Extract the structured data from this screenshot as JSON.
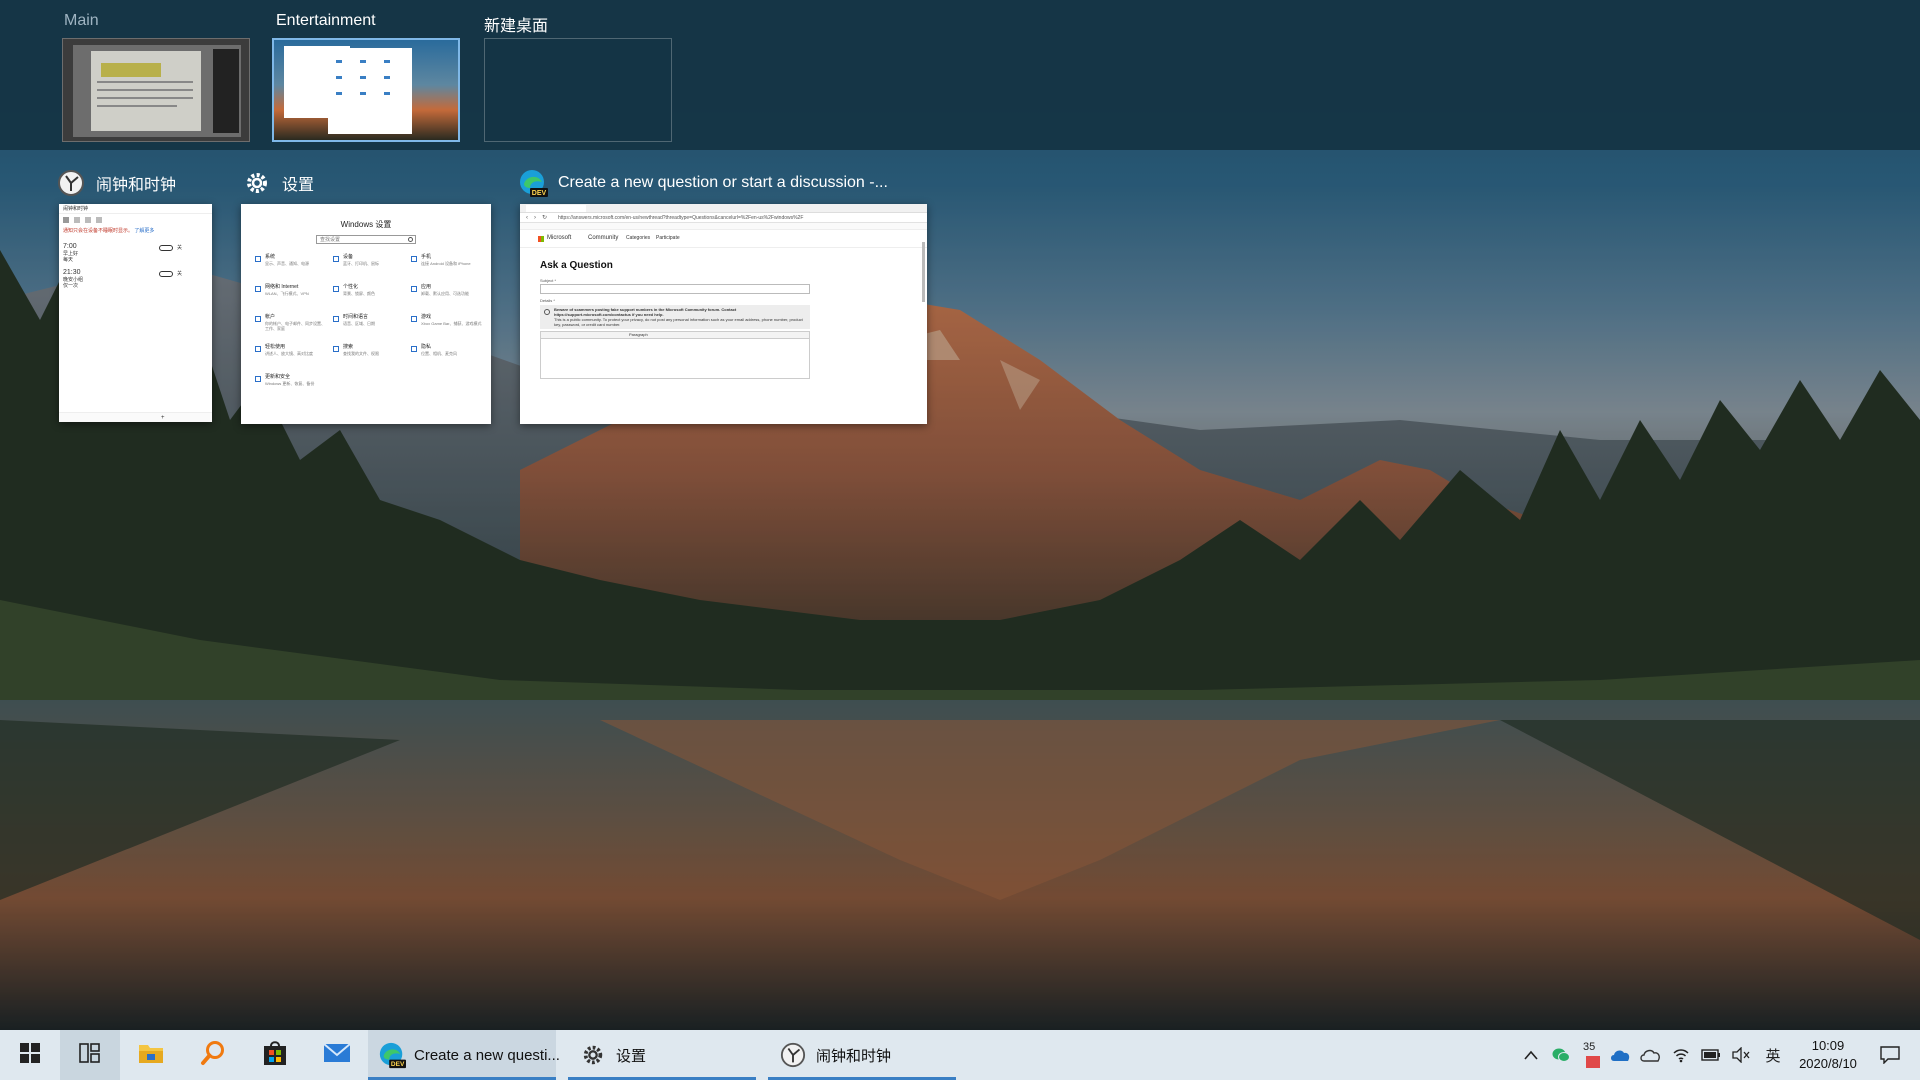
{
  "desktops": [
    {
      "label": "Main",
      "active": false
    },
    {
      "label": "Entertainment",
      "active": true
    },
    {
      "label": "新建桌面",
      "active": false
    }
  ],
  "windows": {
    "clock": {
      "title": "闹钟和时钟",
      "app_name": "闹钟和时钟",
      "notice": "通知只会在设备不睡眠时显示。",
      "notice_link": "了解更多",
      "alarms": [
        {
          "time": "7:00",
          "line1": "早上好",
          "line2": "每天",
          "state": "关"
        },
        {
          "time": "21:30",
          "line1": "晚安小组",
          "line2": "仅一次",
          "state": "关"
        }
      ],
      "add_button": "+"
    },
    "settings": {
      "title": "设置",
      "header": "Windows 设置",
      "search_placeholder": "查找设置",
      "items": [
        {
          "name": "系统",
          "desc": "显示、声音、通知、电源"
        },
        {
          "name": "设备",
          "desc": "蓝牙、打印机、鼠标"
        },
        {
          "name": "手机",
          "desc": "连接 Android 设备和 iPhone"
        },
        {
          "name": "网络和 Internet",
          "desc": "WLAN、飞行模式、VPN"
        },
        {
          "name": "个性化",
          "desc": "背景、锁屏、颜色"
        },
        {
          "name": "应用",
          "desc": "卸载、默认应用、可选功能"
        },
        {
          "name": "帐户",
          "desc": "你的帐户、电子邮件、同步设置、工作、家庭"
        },
        {
          "name": "时间和语言",
          "desc": "语音、区域、日期"
        },
        {
          "name": "游戏",
          "desc": "Xbox Game Bar、捕获、游戏模式"
        },
        {
          "name": "轻松使用",
          "desc": "讲述人、放大镜、高对比度"
        },
        {
          "name": "搜索",
          "desc": "查找我的文件、权限"
        },
        {
          "name": "隐私",
          "desc": "位置、相机、麦克风"
        },
        {
          "name": "更新和安全",
          "desc": "Windows 更新、恢复、备份"
        }
      ]
    },
    "edge": {
      "title": "Create a new question or start a discussion -...",
      "url": "https://answers.microsoft.com/en-us/newthread?threadtype=Questions&cancelurl=%2Fen-us%2Fwindows%2F",
      "site_name": "Microsoft",
      "nav_items": [
        "Community",
        "Categories",
        "Participate"
      ],
      "page_heading": "Ask a Question",
      "subject_label": "Subject *",
      "details_label": "Details *",
      "warning_title": "Beware of scammers posting fake support numbers in the Microsoft Community forum. Contact https://support.microsoft.com/contactus if you need help.",
      "warning_body": "This is a public community. To protect your privacy, do not post any personal information such as your email address, phone number, product key, password, or credit card number.",
      "format_label": "Paragraph"
    }
  },
  "taskbar": {
    "apps": [
      {
        "label": "Create a new questi...",
        "icon": "edge-dev-icon"
      },
      {
        "label": "设置",
        "icon": "gear-icon"
      },
      {
        "label": "闹钟和时钟",
        "icon": "alarm-clock-icon"
      }
    ],
    "tray": {
      "temperature": "35",
      "ime": "英",
      "time": "10:09",
      "date": "2020/8/10"
    }
  },
  "colors": {
    "accent": "#3a7fc4",
    "strip": "#14344a",
    "taskbar": "#dfe8ef"
  }
}
